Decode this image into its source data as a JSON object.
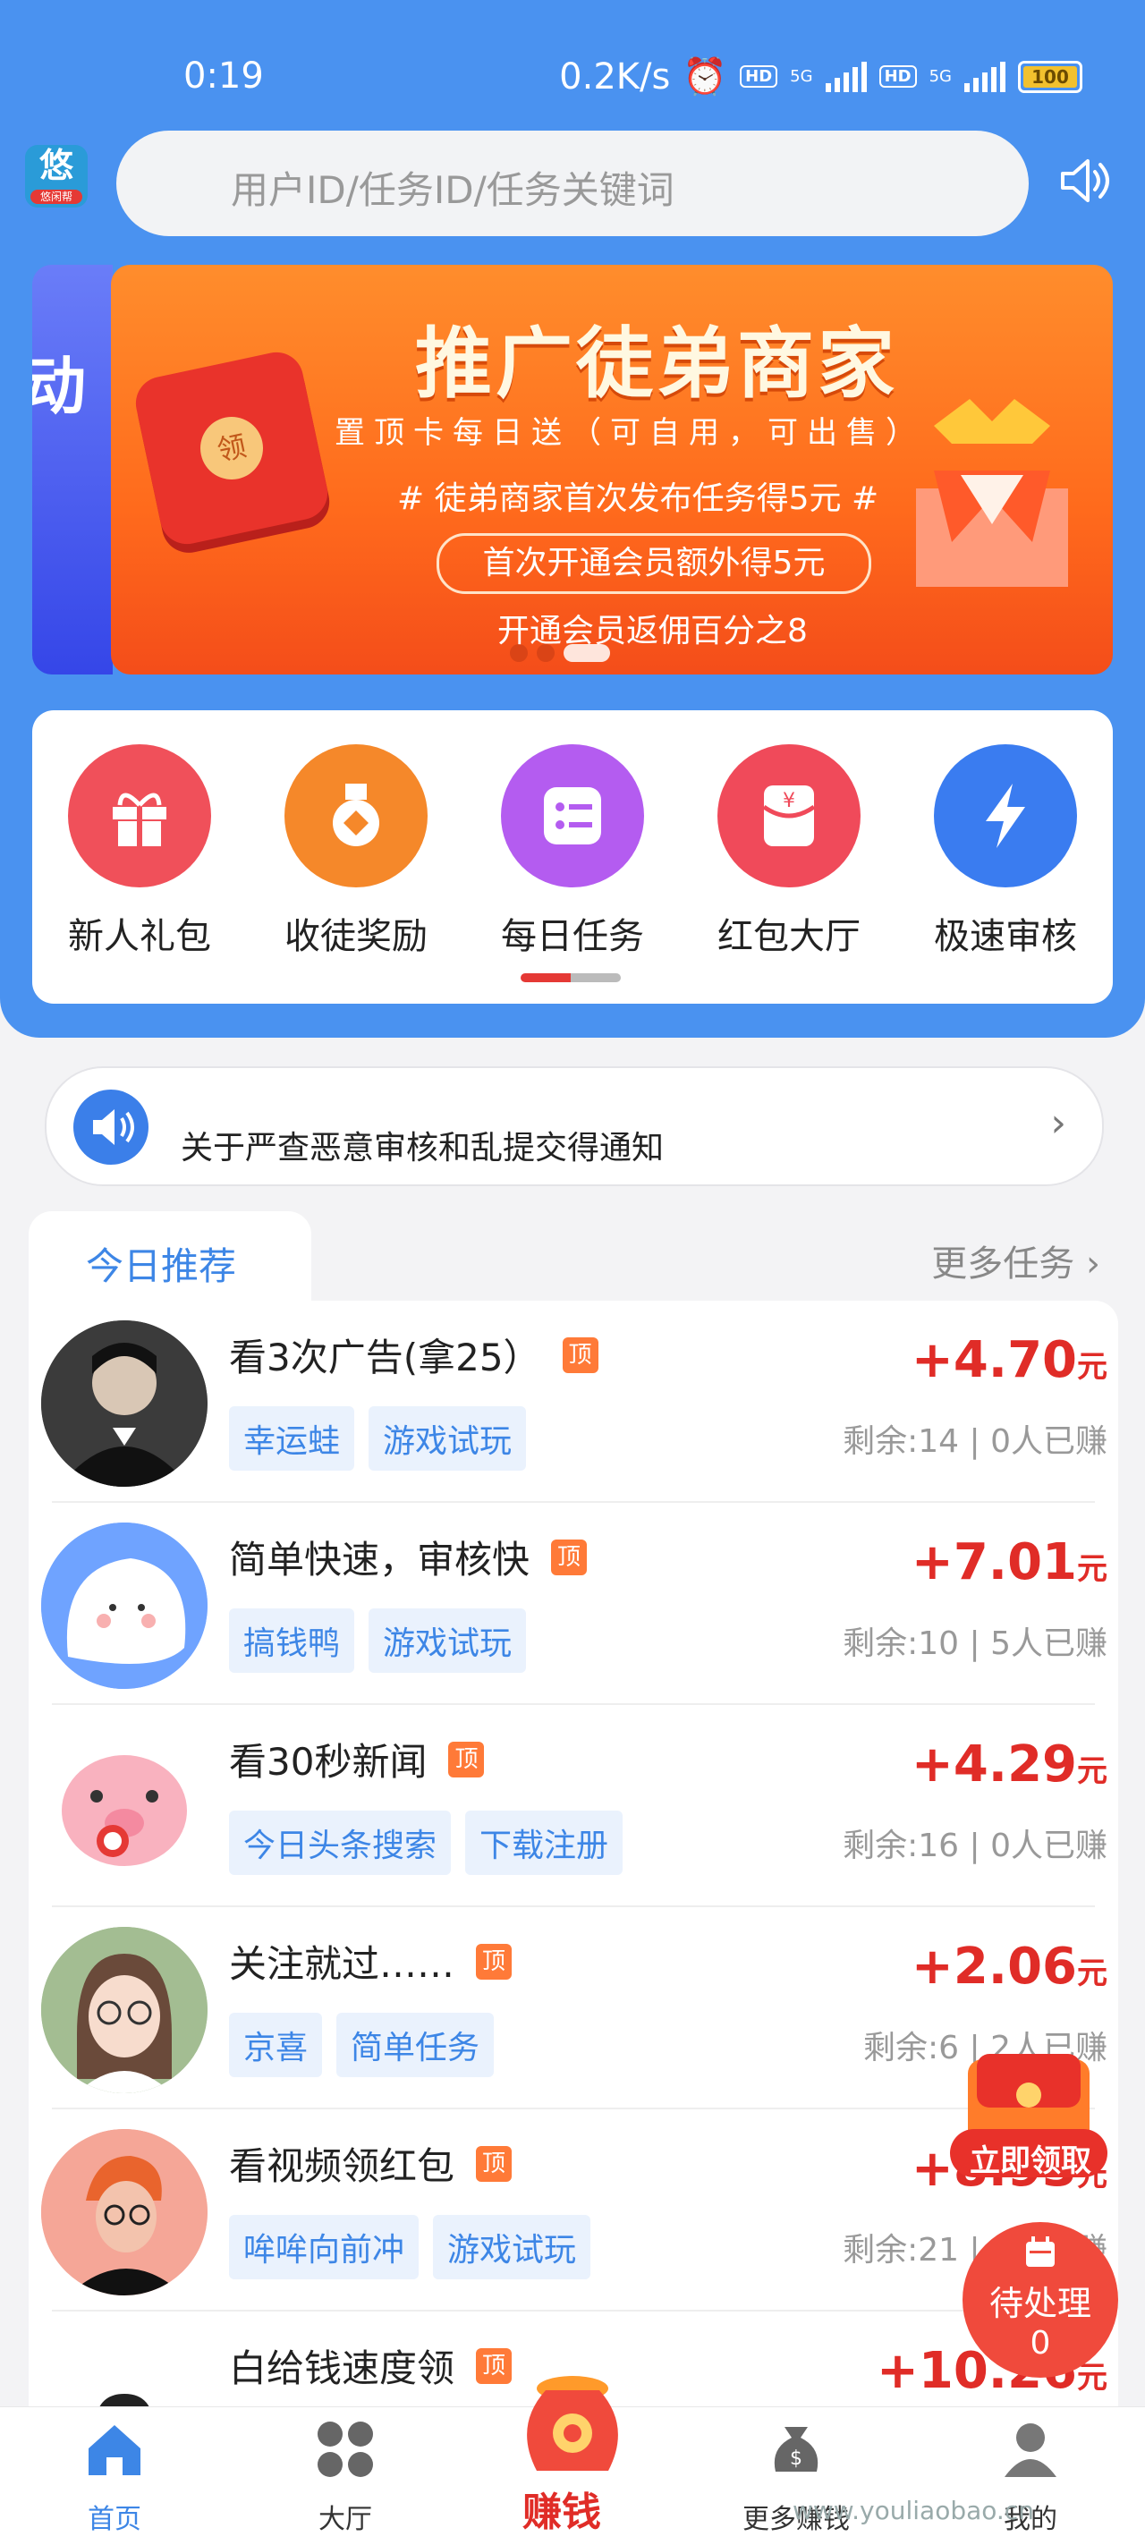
{
  "status_bar": {
    "time": "0:19",
    "net_speed": "0.2K/s",
    "hd1": "HD",
    "hd2": "HD",
    "net_type": "5G",
    "battery": "100"
  },
  "app_logo": {
    "text": "悠",
    "sub": "悠闲帮"
  },
  "search": {
    "placeholder": "用户ID/任务ID/任务关键词"
  },
  "banner": {
    "left_peek_text": "动",
    "title": "推广徒弟商家",
    "subtitle": "置顶卡每日送（可自用，可出售）",
    "line1": "# 徒弟商家首次发布任务得5元 #",
    "pill": "首次开通会员额外得5元",
    "line3": "开通会员返佣百分之8",
    "coin": "领"
  },
  "features": [
    {
      "label": "新人礼包",
      "icon": "gift-icon",
      "color": "#f0505a"
    },
    {
      "label": "收徒奖励",
      "icon": "medal-icon",
      "color": "#f5882a"
    },
    {
      "label": "每日任务",
      "icon": "checklist-icon",
      "color": "#b45cf0"
    },
    {
      "label": "红包大厅",
      "icon": "red-envelope-icon",
      "color": "#f04a5a"
    },
    {
      "label": "极速审核",
      "icon": "lightning-icon",
      "color": "#3a7cf0"
    }
  ],
  "notice": {
    "text": "关于严查恶意审核和乱提交得通知"
  },
  "tabs": {
    "today": "今日推荐",
    "more": "更多任务 ›"
  },
  "tasks": [
    {
      "title": "看3次广告(拿25）",
      "badge": "顶",
      "tags": [
        "幸运蛙",
        "游戏试玩"
      ],
      "price": "+4.70",
      "unit": "元",
      "meta": "剩余:14 | 0人已赚"
    },
    {
      "title": "简单快速，审核快",
      "badge": "顶",
      "tags": [
        "搞钱鸭",
        "游戏试玩"
      ],
      "price": "+7.01",
      "unit": "元",
      "meta": "剩余:10 | 5人已赚"
    },
    {
      "title": "看30秒新闻",
      "badge": "顶",
      "tags": [
        "今日头条搜索",
        "下载注册"
      ],
      "price": "+4.29",
      "unit": "元",
      "meta": "剩余:16 | 0人已赚"
    },
    {
      "title": "关注就过……",
      "badge": "顶",
      "tags": [
        "京喜",
        "简单任务"
      ],
      "price": "+2.06",
      "unit": "元",
      "meta": "剩余:6 | 2人已赚"
    },
    {
      "title": "看视频领红包",
      "badge": "顶",
      "tags": [
        "哞哞向前冲",
        "游戏试玩"
      ],
      "price": "+8.93",
      "unit": "元",
      "meta": "剩余:21 | 1人已赚"
    },
    {
      "title": "白给钱速度领",
      "badge": "顶",
      "tags": [],
      "price": "+10.26",
      "unit": "元",
      "meta": ""
    }
  ],
  "float_red_packet": {
    "label": "立即领取"
  },
  "pending": {
    "label": "待处理",
    "count": "0"
  },
  "nav": [
    {
      "label": "首页",
      "icon": "home-icon"
    },
    {
      "label": "大厅",
      "icon": "grid-icon"
    },
    {
      "label": "赚钱",
      "icon": "money-bag-icon"
    },
    {
      "label": "更多赚钱",
      "icon": "coin-bag-icon"
    },
    {
      "label": "我的",
      "icon": "user-icon"
    }
  ],
  "watermark": "www.youliaobao.cn"
}
